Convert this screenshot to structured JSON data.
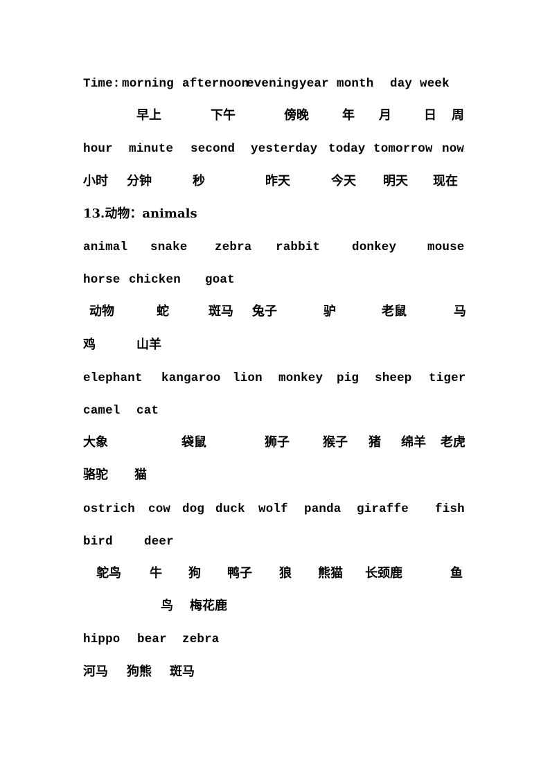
{
  "document": {
    "lines": [
      {
        "type": "en",
        "words": [
          "Time:",
          "morning",
          "afternoon",
          "evening",
          "year",
          "month",
          "day",
          "week"
        ]
      },
      {
        "type": "zh",
        "words": [
          "早上",
          "下午",
          "傍晚",
          "年",
          "月",
          "日",
          "周"
        ]
      },
      {
        "type": "en",
        "words": [
          "hour",
          "minute",
          "second",
          "yesterday",
          "today",
          "tomorrow",
          "now"
        ]
      },
      {
        "type": "zh",
        "words": [
          "小时",
          "分钟",
          "秒",
          "昨天",
          "今天",
          "明天",
          "现在"
        ]
      },
      {
        "type": "heading",
        "words": [
          "13.动物：animals"
        ]
      },
      {
        "type": "en",
        "words": [
          "animal",
          "snake",
          "zebra",
          "rabbit",
          "donkey",
          "mouse"
        ]
      },
      {
        "type": "en",
        "words": [
          "horse",
          "chicken",
          "goat"
        ]
      },
      {
        "type": "zh",
        "words": [
          "动物",
          "蛇",
          "斑马",
          "兔子",
          "驴",
          "老鼠",
          "马"
        ]
      },
      {
        "type": "zh",
        "words": [
          "鸡",
          "山羊"
        ]
      },
      {
        "type": "en",
        "words": [
          "elephant",
          "kangaroo",
          "lion",
          "monkey",
          "pig",
          "sheep",
          "tiger"
        ]
      },
      {
        "type": "en",
        "words": [
          "camel",
          "cat"
        ]
      },
      {
        "type": "zh",
        "words": [
          "大象",
          "袋鼠",
          "狮子",
          "猴子",
          "猪",
          "绵羊",
          "老虎"
        ]
      },
      {
        "type": "zh",
        "words": [
          "骆驼",
          "猫"
        ]
      },
      {
        "type": "en",
        "words": [
          "ostrich",
          "cow",
          "dog",
          "duck",
          "wolf",
          "panda",
          "giraffe",
          "fish"
        ]
      },
      {
        "type": "en",
        "words": [
          "bird",
          "deer"
        ]
      },
      {
        "type": "zh",
        "words": [
          "鸵鸟",
          "牛",
          "狗",
          "鸭子",
          "狼",
          "熊猫",
          "长颈鹿",
          "鱼"
        ]
      },
      {
        "type": "zh",
        "words": [
          "鸟",
          "梅花鹿"
        ]
      },
      {
        "type": "en",
        "words": [
          "hippo",
          "bear",
          "zebra"
        ]
      },
      {
        "type": "zh",
        "words": [
          "河马",
          "狗熊",
          "斑马"
        ]
      }
    ]
  }
}
